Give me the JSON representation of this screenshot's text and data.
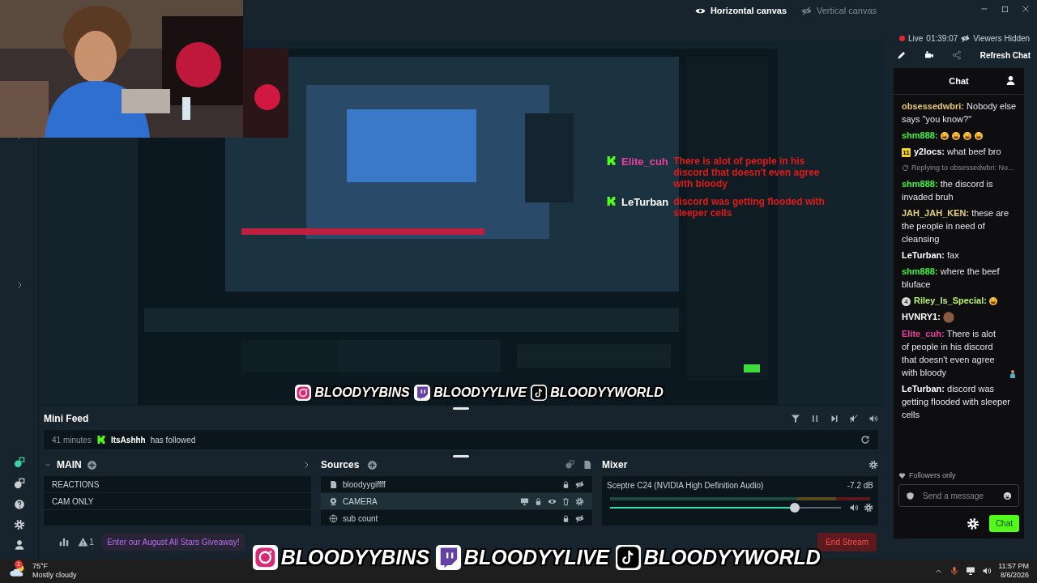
{
  "canvas_toggles": [
    {
      "label": "Horizontal canvas",
      "selected": true
    },
    {
      "label": "Vertical canvas",
      "selected": false
    }
  ],
  "preview": {
    "kind": "picture",
    "overlay_chat": [
      {
        "user": "Elite_cuh",
        "color": "#e8409c",
        "message": "There is alot of people in his discord that doesn't even agree with bloody"
      },
      {
        "user": "LeTurban",
        "color": "#ffffff",
        "message": "discord was getting flooded with sleeper cells"
      }
    ],
    "socials": [
      {
        "kind": "instagram",
        "handle": "BLOODYYBINS"
      },
      {
        "kind": "twitch",
        "handle": "BLOODYYLIVE"
      },
      {
        "kind": "tiktok",
        "handle": "BLOODYYWORLD"
      }
    ]
  },
  "mini_feed": {
    "title": "Mini Feed",
    "events": [
      {
        "time": "41 minutes",
        "user": "ItsAshhh",
        "action": "has followed"
      }
    ]
  },
  "scenes": {
    "title": "MAIN",
    "items": [
      {
        "label": "REACTIONS",
        "selected": false
      },
      {
        "label": "CAM ONLY",
        "selected": false
      }
    ]
  },
  "sources": {
    "title": "Sources",
    "items": [
      {
        "label": "bloodyygiffff",
        "kind": "file",
        "selected": false
      },
      {
        "label": "CAMERA",
        "kind": "camera",
        "selected": true
      },
      {
        "label": "sub count",
        "kind": "browser",
        "selected": false
      }
    ]
  },
  "mixer": {
    "title": "Mixer",
    "channels": [
      {
        "name": "Sceptre C24 (NVIDIA High Definition Audio)",
        "reading": "-7.2 dB",
        "level": 0.8
      }
    ]
  },
  "footer": {
    "alert_count": "1",
    "giveaway": "Enter our August All Stars Giveaway!",
    "end_stream": "End Stream"
  },
  "chat": {
    "live": "Live",
    "timer": "01:39:07",
    "viewers": "Viewers Hidden",
    "refresh": "Refresh Chat",
    "title": "Chat",
    "messages": [
      {
        "kind": "message",
        "user": "obsessedwbri:",
        "color": "#e6c86e",
        "text": "Nobody else says \"you know?\""
      },
      {
        "kind": "message",
        "user": "shm888:",
        "color": "#3ff23f",
        "emotes": [
          {
            "kind": "laugh"
          },
          {
            "kind": "laugh"
          },
          {
            "kind": "laugh"
          },
          {
            "kind": "laugh"
          }
        ]
      },
      {
        "kind": "message",
        "badge": {
          "kind": "sub",
          "text": "11"
        },
        "user": "y2locs:",
        "color": "#ffffff",
        "text": "what beef bro"
      },
      {
        "kind": "reply",
        "text": "Replying to obsessedwbri: No..."
      },
      {
        "kind": "message",
        "user": "shm888:",
        "color": "#3ff23f",
        "text": "the discord is invaded bruh"
      },
      {
        "kind": "message",
        "user": "JAH_JAH_KEN:",
        "color": "#e6d27a",
        "text": "these are the people in need of cleansing"
      },
      {
        "kind": "message",
        "user": "LeTurban:",
        "color": "#ffffff",
        "text": "fax"
      },
      {
        "kind": "message",
        "user": "shm888:",
        "color": "#3ff23f",
        "text": "where the beef bluface"
      },
      {
        "kind": "message",
        "badge": {
          "kind": "rank",
          "text": "4"
        },
        "user": "Riley_Is_Special:",
        "color": "#b9f26c",
        "emotes": [
          {
            "kind": "laugh"
          }
        ]
      },
      {
        "kind": "message",
        "user": "HVNRY1:",
        "color": "#ffffff",
        "emotes": [
          {
            "kind": "face"
          }
        ]
      },
      {
        "kind": "message",
        "user": "Elite_cuh:",
        "color": "#e8409c",
        "text": "There is alot of people in his discord that doesn't even agree with bloody",
        "emotes": [
          {
            "kind": "figure"
          }
        ]
      },
      {
        "kind": "message",
        "user": "LeTurban:",
        "color": "#ffffff",
        "text": "discord was getting flooded with sleeper cells"
      }
    ],
    "followers_only": "Followers only",
    "placeholder": "Send a message",
    "send": "Chat"
  },
  "overlay": {
    "socials": [
      {
        "kind": "instagram",
        "handle": "BLOODYYBINS"
      },
      {
        "kind": "twitch",
        "handle": "BLOODYYLIVE"
      },
      {
        "kind": "tiktok",
        "handle": "BLOODYYWORLD"
      }
    ]
  },
  "taskbar": {
    "weather_badge": "1",
    "temperature": "75°F",
    "weather": "Mostly cloudy",
    "time": "11:57 PM",
    "date": "8/6/2026"
  }
}
